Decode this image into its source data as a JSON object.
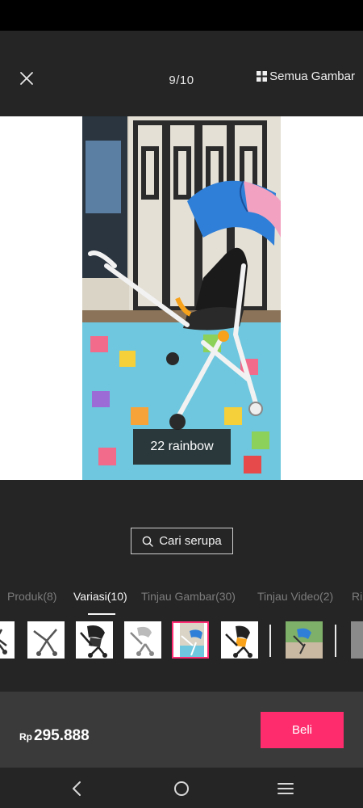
{
  "header": {
    "counter": "9/10",
    "all_images_label": "Semua Gambar"
  },
  "image": {
    "variant_caption": "22 rainbow"
  },
  "search_similar": {
    "label": "Cari serupa"
  },
  "tabs": [
    {
      "label": "Produk(8)"
    },
    {
      "label": "Variasi(10)"
    },
    {
      "label": "Tinjau Gambar(30)"
    },
    {
      "label": "Tinjau Video(2)"
    },
    {
      "label": "Ri"
    }
  ],
  "purchase": {
    "currency": "Rp",
    "price": "295.888",
    "buy_label": "Beli"
  },
  "colors": {
    "accent": "#fe2c6d",
    "background": "#252525",
    "bottom_bar": "#3a3a3a"
  }
}
